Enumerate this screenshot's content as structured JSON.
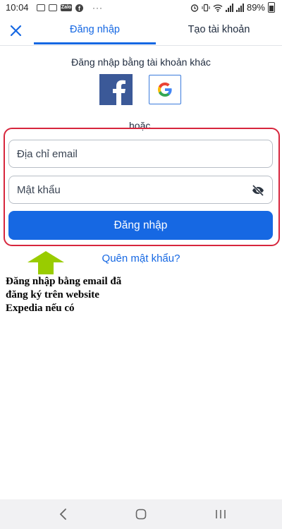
{
  "status_bar": {
    "time": "10:04",
    "battery": "89%",
    "left_icons": [
      "message-icon",
      "message-icon",
      "zalo-icon",
      "facebook-icon",
      "more-dots-icon"
    ],
    "zalo_text": "Zalo",
    "more": "···",
    "right_icons": [
      "alarm-icon",
      "vibrate-icon",
      "wifi-icon",
      "signal-icon",
      "signal-icon",
      "battery-icon"
    ]
  },
  "tabs": {
    "login": "Đăng nhập",
    "create_account": "Tạo tài khoản",
    "active": "login",
    "close_icon": "close-icon"
  },
  "social": {
    "label": "Đăng nhập bằng tài khoản khác",
    "facebook_icon": "facebook-icon",
    "google_icon": "google-icon",
    "or": "hoặc"
  },
  "form": {
    "email_placeholder": "Địa chỉ email",
    "password_placeholder": "Mật khẩu",
    "eye_icon": "eye-off-icon",
    "submit": "Đăng nhập",
    "forgot": "Quên mật khẩu?"
  },
  "annotation": {
    "lines": [
      "Đăng nhập bằng email đã",
      "đăng ký trên website",
      "Expedia nếu có"
    ],
    "arrow_color": "#99cc00",
    "highlight_color": "#d7263d"
  },
  "colors": {
    "accent": "#1668e3",
    "facebook": "#3b5998"
  },
  "nav_bar": {
    "icons": [
      "back-icon",
      "home-icon",
      "recents-icon"
    ]
  }
}
